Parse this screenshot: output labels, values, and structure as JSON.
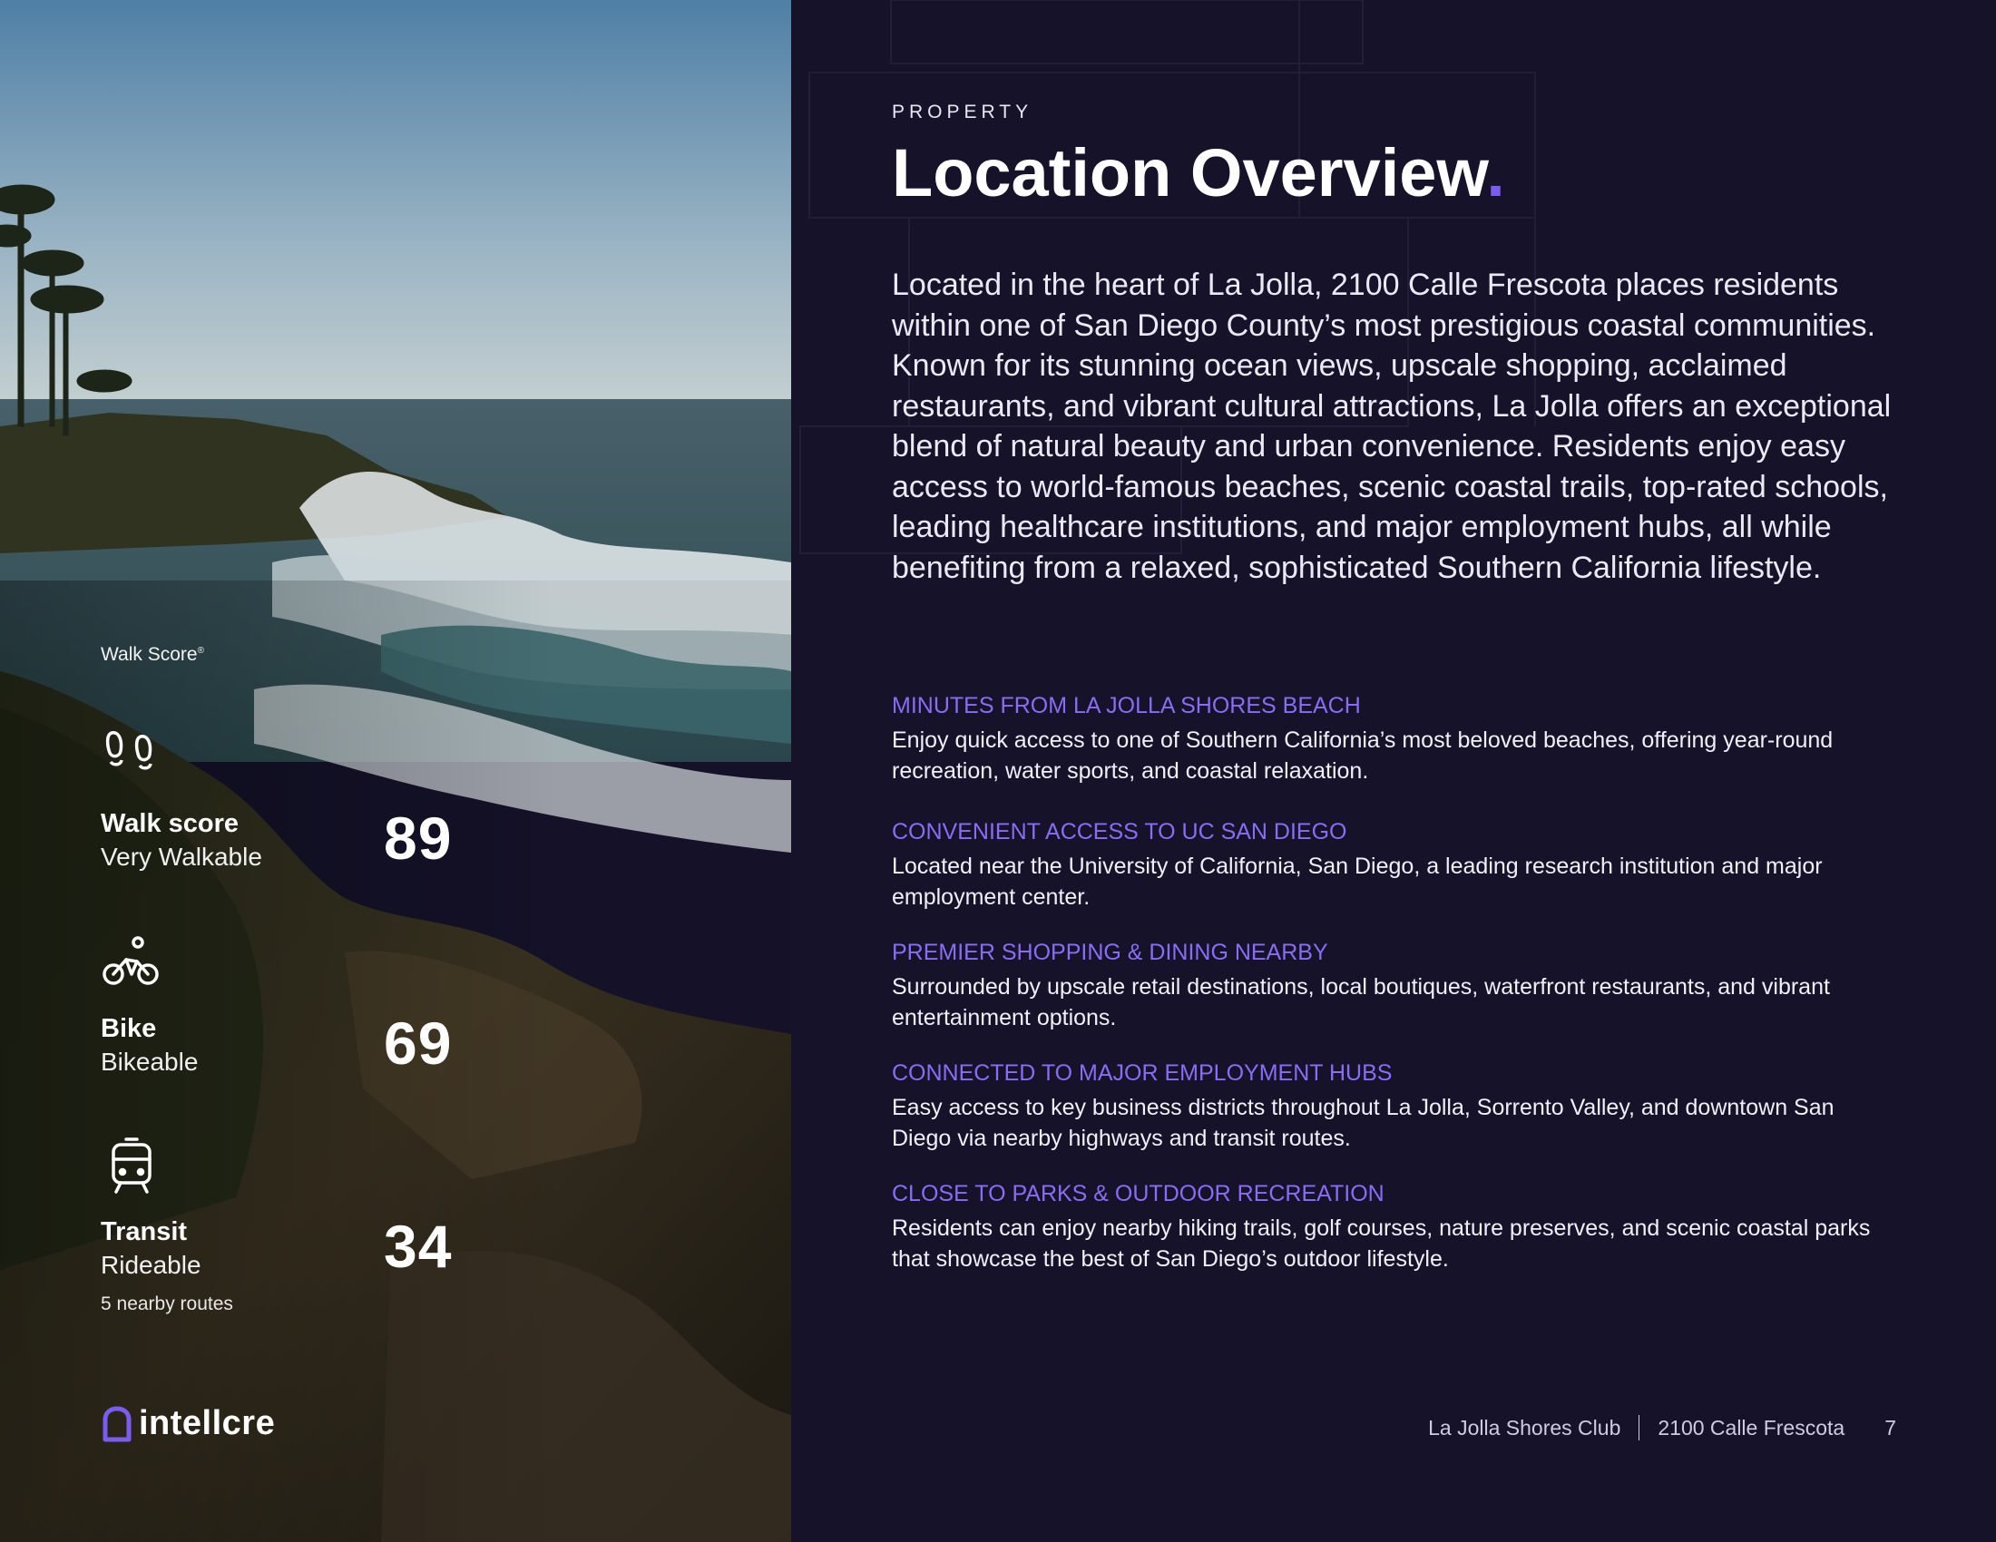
{
  "walk_score_section": {
    "heading": "Walk Score",
    "trademark": "®",
    "scores": [
      {
        "icon": "footprints-icon",
        "title": "Walk score",
        "subtitle": "Very Walkable",
        "value": "89"
      },
      {
        "icon": "bicycle-icon",
        "title": "Bike",
        "subtitle": "Bikeable",
        "value": "69"
      },
      {
        "icon": "tram-icon",
        "title": "Transit",
        "subtitle": "Rideable",
        "value": "34",
        "note": "5 nearby routes"
      }
    ]
  },
  "brand": {
    "logo_text": "intellcre",
    "logo_icon": "house-outline-icon",
    "accent": "#7b5cf0"
  },
  "header": {
    "eyebrow": "PROPERTY",
    "title": "Location Overview",
    "title_dot": "."
  },
  "intro": "Located in the heart of La Jolla, 2100 Calle Frescota places residents within one of San Diego County’s most prestigious coastal communities. Known for its stunning ocean views, upscale shopping, acclaimed restaurants, and vibrant cultural attractions, La Jolla offers an exceptional blend of natural beauty and urban convenience. Residents enjoy easy access to world-famous beaches, scenic coastal trails, top-rated schools, leading healthcare institutions, and major employment hubs, all while benefiting from a relaxed, sophisticated Southern California lifestyle.",
  "features": [
    {
      "heading": "MINUTES FROM LA JOLLA SHORES BEACH",
      "body": "Enjoy quick access to one of Southern California’s most beloved beaches, offering year-round recreation, water sports, and coastal relaxation."
    },
    {
      "heading": "CONVENIENT ACCESS TO UC SAN DIEGO",
      "body": "Located near the University of California, San Diego, a leading research institution and major employment center."
    },
    {
      "heading": "PREMIER SHOPPING & DINING NEARBY",
      "body": "Surrounded by upscale retail destinations, local boutiques, waterfront restaurants, and vibrant entertainment options."
    },
    {
      "heading": "CONNECTED TO MAJOR EMPLOYMENT HUBS",
      "body": "Easy access to key business districts throughout La Jolla, Sorrento Valley, and downtown San Diego via nearby highways and transit routes."
    },
    {
      "heading": "CLOSE TO PARKS & OUTDOOR RECREATION",
      "body": "Residents can enjoy nearby hiking trails, golf courses, nature preserves, and scenic coastal parks that showcase the best of San Diego’s outdoor lifestyle."
    }
  ],
  "footer": {
    "property_name": "La Jolla Shores Club",
    "address": "2100 Calle Frescota",
    "page_number": "7"
  },
  "colors": {
    "background": "#15122a",
    "accent": "#7b5cf0",
    "feature_heading": "#8a6cf5"
  }
}
